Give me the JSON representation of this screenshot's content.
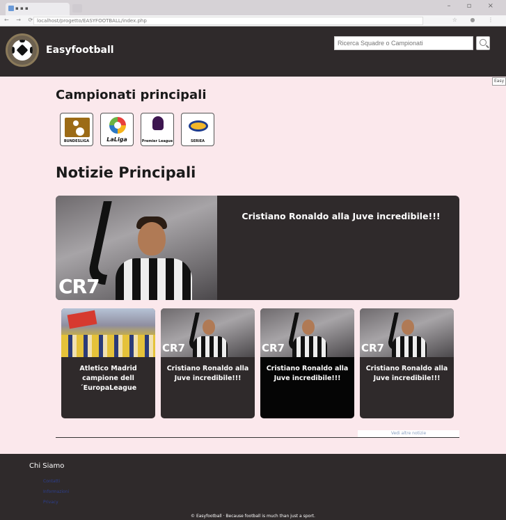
{
  "browser": {
    "tab_title": "▪ ▪ ▪",
    "url": "localhost/progetto/EASYFOOTBALL/index.php",
    "window_controls": "– ▫ ×",
    "nav": "← → ⟳",
    "extensions": "☆ ● ⋮"
  },
  "header": {
    "brand": "Easyfootball",
    "search_placeholder": "Ricerca Squadre o Campionati",
    "side_tab": "Easy"
  },
  "leagues": {
    "title": "Campionati principali",
    "items": [
      {
        "label": "BUNDESLIGA"
      },
      {
        "label": "LaLiga"
      },
      {
        "label": "Premier League"
      },
      {
        "label": "SERIEA"
      }
    ]
  },
  "news": {
    "title": "Notizie Principali",
    "featured": {
      "title": "Cristiano Ronaldo alla Juve incredibile!!!",
      "image_text": "CR7"
    },
    "cards": [
      {
        "title": "Atletico Madrid campione dell´EuropaLeague"
      },
      {
        "title": "Cristiano Ronaldo alla Juve incredibile!!!",
        "image_text": "CR7"
      },
      {
        "title": "Cristiano Ronaldo alla Juve incredibile!!!",
        "image_text": "CR7"
      },
      {
        "title": "Cristiano Ronaldo alla Juve incredibile!!!",
        "image_text": "CR7"
      }
    ],
    "more_label": "Vedi altre notizie"
  },
  "footer": {
    "heading": "Chi Siamo",
    "links": [
      "Contatti",
      "Informazioni",
      "Privacy"
    ],
    "copyright": "© Easyfootball · Because football is much than just a sport."
  },
  "colors": {
    "page_bg": "#fbe8ec",
    "header_bg": "#2f2a2b",
    "link": "#2d3f8f"
  }
}
